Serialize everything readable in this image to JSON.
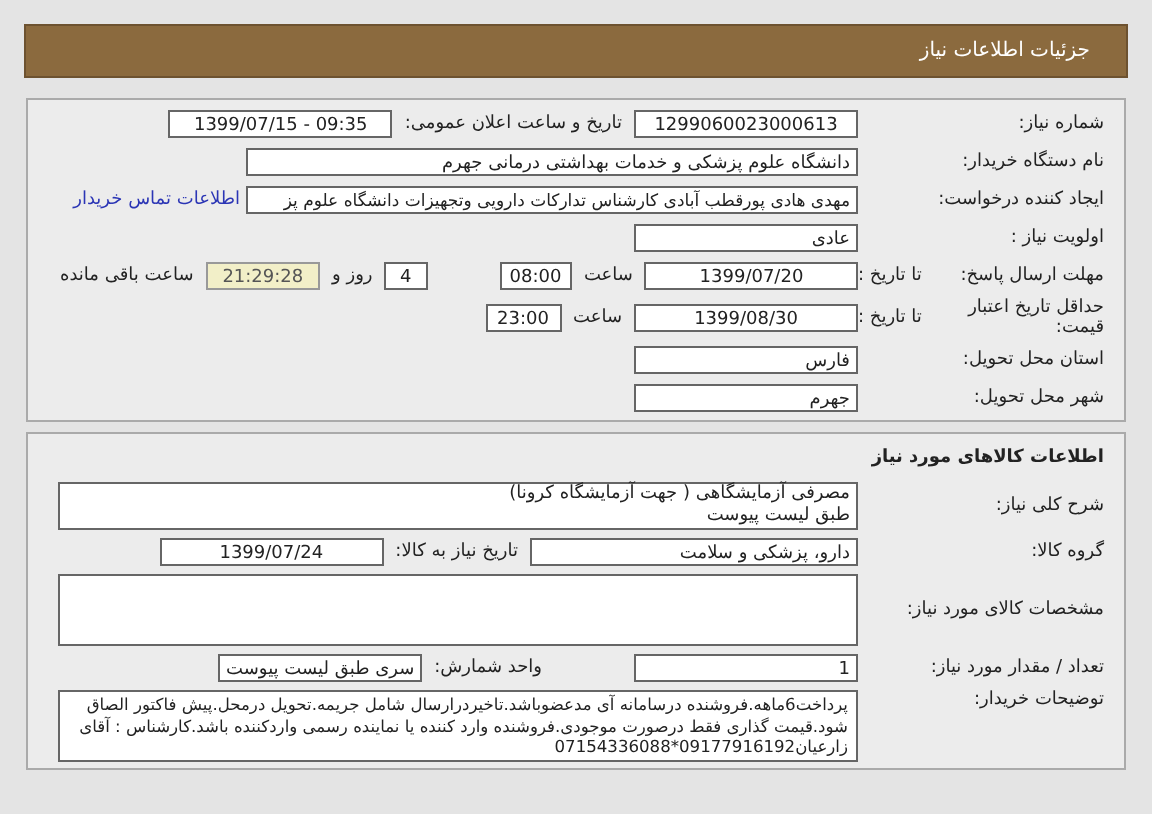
{
  "header": {
    "title": "جزئیات اطلاعات نیاز"
  },
  "details": {
    "need_number": {
      "label": "شماره نیاز:",
      "value": "1299060023000613"
    },
    "announce": {
      "label": "تاریخ و ساعت اعلان عمومی:",
      "value": "1399/07/15 - 09:35"
    },
    "buyer": {
      "label": "نام دستگاه خریدار:",
      "value": "دانشگاه علوم پزشکی و خدمات بهداشتی درمانی جهرم"
    },
    "creator": {
      "label": "ایجاد کننده درخواست:",
      "value": "مهدی هادی پورقطب آبادی کارشناس تدارکات دارویی وتجهیزات دانشگاه علوم پز",
      "link": "اطلاعات تماس خریدار"
    },
    "priority": {
      "label": "اولویت نیاز :",
      "value": "عادی"
    },
    "deadline": {
      "label": "مهلت ارسال پاسخ:",
      "to_label": "تا تاریخ :",
      "date": "1399/07/20",
      "time_label": "ساعت",
      "time": "08:00",
      "days": "4",
      "days_label": "روز و",
      "remaining": "21:29:28",
      "remaining_label": "ساعت باقی مانده"
    },
    "validity": {
      "label": "حداقل تاریخ اعتبار قیمت:",
      "to_label": "تا تاریخ :",
      "date": "1399/08/30",
      "time_label": "ساعت",
      "time": "23:00"
    },
    "province": {
      "label": "استان محل تحویل:",
      "value": "فارس"
    },
    "city": {
      "label": "شهر محل تحویل:",
      "value": "جهرم"
    }
  },
  "goods": {
    "title": "اطلاعات کالاهای مورد نیاز",
    "description": {
      "label": "شرح کلی نیاز:",
      "lines": [
        "مصرفی آزمایشگاهی ( جهت آزمایشگاه کرونا)",
        "طبق لیست پیوست"
      ]
    },
    "group": {
      "label": "گروه کالا:",
      "value": "دارو، پزشکی و سلامت",
      "date_label": "تاریخ نیاز به کالا:",
      "date": "1399/07/24"
    },
    "specs": {
      "label": "مشخصات کالای مورد نیاز:"
    },
    "quantity": {
      "label": "تعداد / مقدار مورد نیاز:",
      "value": "1",
      "unit_label": "واحد شمارش:",
      "unit": "سری طبق لیست پیوست"
    },
    "notes": {
      "label": "توضیحات خریدار:",
      "value": "پرداخت6ماهه.فروشنده درسامانه آی مدعضوباشد.تاخیردرارسال شامل جریمه.تحویل درمحل.پیش فاکتور الصاق شود.قیمت گذاری فقط درصورت موجودی.فروشنده وارد کننده یا نماینده رسمی واردکننده باشد.کارشناس : آقای زارعیان09177916192*07154336088"
    }
  }
}
